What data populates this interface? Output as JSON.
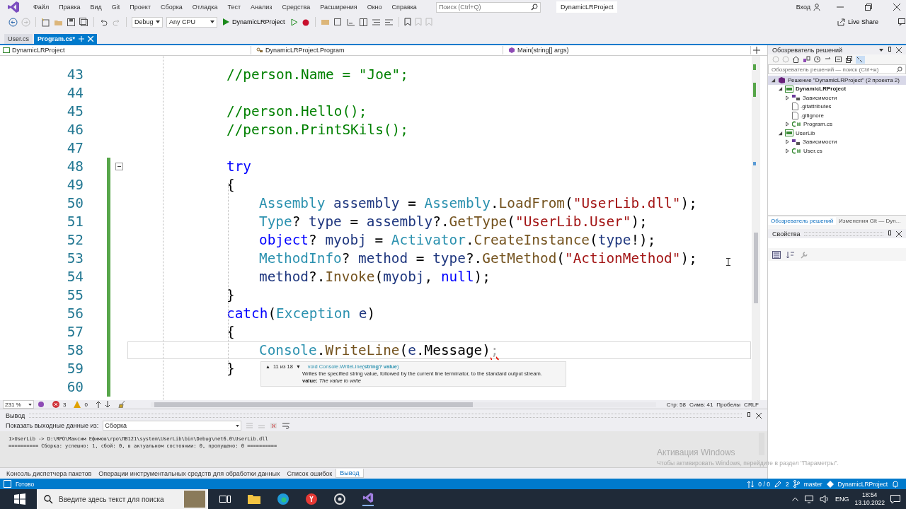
{
  "title_bar": {
    "menu": [
      "Файл",
      "Правка",
      "Вид",
      "Git",
      "Проект",
      "Сборка",
      "Отладка",
      "Тест",
      "Анализ",
      "Средства",
      "Расширения",
      "Окно",
      "Справка"
    ],
    "search": {
      "placeholder": "Поиск (Ctrl+Q)"
    },
    "title": "DynamicLRProject",
    "sign_in": "Вход"
  },
  "toolbar": {
    "configuration": "Debug",
    "platform": "Any CPU",
    "run_target": "DynamicLRProject",
    "live_share": "Live Share"
  },
  "doc_tabs": [
    {
      "label": "User.cs",
      "selected": false
    },
    {
      "label": "Program.cs*",
      "selected": true
    }
  ],
  "nav_bar": {
    "project": "DynamicLRProject",
    "class": "DynamicLRProject.Program",
    "member": "Main(string[] args)"
  },
  "editor": {
    "lines": [
      {
        "number": "43",
        "kind": "outer",
        "changed": false,
        "collapsible": false,
        "current": false,
        "tokens": [
          {
            "kind": "comment",
            "text": "//person.Name = \"Joe\";"
          }
        ]
      },
      {
        "number": "44",
        "kind": "blank",
        "changed": false,
        "collapsible": false,
        "current": false
      },
      {
        "number": "45",
        "kind": "outer",
        "changed": false,
        "collapsible": false,
        "current": false,
        "tokens": [
          {
            "kind": "comment",
            "text": "//person.Hello();"
          }
        ]
      },
      {
        "number": "46",
        "kind": "outer",
        "changed": false,
        "collapsible": false,
        "current": false,
        "tokens": [
          {
            "kind": "comment",
            "text": "//person.PrintSKils();"
          }
        ]
      },
      {
        "number": "47",
        "kind": "blank",
        "changed": false,
        "collapsible": false,
        "current": false
      },
      {
        "number": "48",
        "kind": "outer",
        "changed": true,
        "collapsible": true,
        "current": false,
        "tokens": [
          {
            "kind": "keyword",
            "text": "try"
          }
        ]
      },
      {
        "number": "49",
        "kind": "outer",
        "changed": true,
        "collapsible": false,
        "current": false,
        "tokens": [
          {
            "kind": "plain",
            "text": "{"
          }
        ]
      },
      {
        "number": "50",
        "kind": "inner",
        "changed": true,
        "collapsible": false,
        "current": false,
        "tokens": [
          {
            "kind": "type",
            "text": "Assembly"
          },
          {
            "kind": "local",
            "text": " assembly"
          },
          {
            "kind": "plain",
            "text": " = "
          },
          {
            "kind": "type",
            "text": "Assembly"
          },
          {
            "kind": "plain",
            "text": "."
          },
          {
            "kind": "method",
            "text": "LoadFrom"
          },
          {
            "kind": "plain",
            "text": "("
          },
          {
            "kind": "string",
            "text": "\"UserLib.dll\""
          },
          {
            "kind": "plain",
            "text": ");"
          }
        ]
      },
      {
        "number": "51",
        "kind": "inner",
        "changed": true,
        "collapsible": false,
        "current": false,
        "tokens": [
          {
            "kind": "type",
            "text": "Type"
          },
          {
            "kind": "plain",
            "text": "? "
          },
          {
            "kind": "local",
            "text": "type"
          },
          {
            "kind": "plain",
            "text": " = "
          },
          {
            "kind": "local",
            "text": "assembly"
          },
          {
            "kind": "plain",
            "text": "?."
          },
          {
            "kind": "method",
            "text": "GetType"
          },
          {
            "kind": "plain",
            "text": "("
          },
          {
            "kind": "string",
            "text": "\"UserLib.User\""
          },
          {
            "kind": "plain",
            "text": ");"
          }
        ]
      },
      {
        "number": "52",
        "kind": "inner",
        "changed": true,
        "collapsible": false,
        "current": false,
        "tokens": [
          {
            "kind": "keyword",
            "text": "object"
          },
          {
            "kind": "plain",
            "text": "? "
          },
          {
            "kind": "local",
            "text": "myobj"
          },
          {
            "kind": "plain",
            "text": " = "
          },
          {
            "kind": "type",
            "text": "Activator"
          },
          {
            "kind": "plain",
            "text": "."
          },
          {
            "kind": "method",
            "text": "CreateInstance"
          },
          {
            "kind": "plain",
            "text": "("
          },
          {
            "kind": "local",
            "text": "type"
          },
          {
            "kind": "plain",
            "text": "!);"
          }
        ]
      },
      {
        "number": "53",
        "kind": "inner",
        "changed": true,
        "collapsible": false,
        "current": false,
        "tokens": [
          {
            "kind": "type",
            "text": "MethodInfo"
          },
          {
            "kind": "plain",
            "text": "? "
          },
          {
            "kind": "local",
            "text": "method"
          },
          {
            "kind": "plain",
            "text": " = "
          },
          {
            "kind": "local",
            "text": "type"
          },
          {
            "kind": "plain",
            "text": "?."
          },
          {
            "kind": "method",
            "text": "GetMethod"
          },
          {
            "kind": "plain",
            "text": "("
          },
          {
            "kind": "string",
            "text": "\"ActionMethod\""
          },
          {
            "kind": "plain",
            "text": ");"
          }
        ]
      },
      {
        "number": "54",
        "kind": "inner",
        "changed": true,
        "collapsible": false,
        "current": false,
        "tokens": [
          {
            "kind": "local",
            "text": "method"
          },
          {
            "kind": "plain",
            "text": "?."
          },
          {
            "kind": "method",
            "text": "Invoke"
          },
          {
            "kind": "plain",
            "text": "("
          },
          {
            "kind": "local",
            "text": "myobj"
          },
          {
            "kind": "plain",
            "text": ", "
          },
          {
            "kind": "keyword",
            "text": "null"
          },
          {
            "kind": "plain",
            "text": ");"
          }
        ]
      },
      {
        "number": "55",
        "kind": "outer",
        "changed": true,
        "collapsible": false,
        "current": false,
        "tokens": [
          {
            "kind": "plain",
            "text": "}"
          }
        ]
      },
      {
        "number": "56",
        "kind": "outer",
        "changed": true,
        "collapsible": false,
        "current": false,
        "tokens": [
          {
            "kind": "keyword",
            "text": "catch"
          },
          {
            "kind": "plain",
            "text": "("
          },
          {
            "kind": "type",
            "text": "Exception"
          },
          {
            "kind": "local",
            "text": " e"
          },
          {
            "kind": "plain",
            "text": ")"
          }
        ]
      },
      {
        "number": "57",
        "kind": "outer",
        "changed": true,
        "collapsible": false,
        "current": false,
        "tokens": [
          {
            "kind": "plain",
            "text": "{"
          }
        ]
      },
      {
        "number": "58",
        "kind": "inner",
        "changed": true,
        "collapsible": false,
        "current": true,
        "tokens": [
          {
            "kind": "type",
            "text": "Console"
          },
          {
            "kind": "plain",
            "text": "."
          },
          {
            "kind": "method",
            "text": "WriteLine"
          },
          {
            "kind": "plain",
            "text": "("
          },
          {
            "kind": "local",
            "text": "e"
          },
          {
            "kind": "plain",
            "text": ".Message)"
          },
          {
            "kind": "ghost",
            "text": ";"
          }
        ]
      },
      {
        "number": "59",
        "kind": "outer",
        "changed": true,
        "collapsible": false,
        "current": false,
        "tokens": [
          {
            "kind": "plain",
            "text": "}"
          }
        ]
      },
      {
        "number": "60",
        "kind": "blank",
        "changed": true,
        "collapsible": false,
        "current": false
      }
    ],
    "tooltip": {
      "counter_up": "▲",
      "counter": "11 из 18",
      "counter_down": "▼",
      "signature": "void Console.WriteLine(**string? value**)",
      "description": "Writes the specified string value, followed by the current line terminator, to the standard output stream.",
      "param": "**value:** *The value to write*"
    },
    "status": {
      "zoom": "231 %",
      "errors": "3",
      "warnings": "0",
      "line": "Стр: 58",
      "column": "Симв: 41",
      "whitespace": "Пробелы",
      "line_endings": "CRLF"
    }
  },
  "output": {
    "title": "Вывод",
    "source_label": "Показать выходные данные из:",
    "source": "Сборка",
    "lines": [
      "1>UserLib -> D:\\RPO\\Максим Ефимов\\rpo\\ПВ121\\system\\UserLib\\bin\\Debug\\net6.0\\UserLib.dll",
      "========== Сборка: успешно: 1, сбой: 0, в актуальном состоянии: 0, пропущено: 0 =========="
    ]
  },
  "bottom_tabs": [
    {
      "label": "Консоль диспетчера пакетов",
      "selected": false
    },
    {
      "label": "Операции инструментальных средств для обработки данных",
      "selected": false
    },
    {
      "label": "Список ошибок",
      "selected": false
    },
    {
      "label": "Вывод",
      "selected": true
    }
  ],
  "solution_explorer": {
    "title": "Обозреватель решений",
    "search": {
      "placeholder": "Обозреватель решений — поиск (Ctrl+ж)"
    },
    "tree": [
      {
        "label": "Решение \"DynamicLRProject\" (2 проекта 2)",
        "kind": "solution",
        "bold": false,
        "expandable": true,
        "expanded": true,
        "selected": true,
        "children": [
          {
            "label": "DynamicLRProject",
            "kind": "project",
            "bold": true,
            "expandable": true,
            "expanded": true,
            "selected": false,
            "children": [
              {
                "label": "Зависимости",
                "kind": "deps",
                "bold": false,
                "expandable": true,
                "expanded": false,
                "selected": false
              },
              {
                "label": ".gitattributes",
                "kind": "file",
                "bold": false,
                "expandable": false,
                "expanded": false,
                "selected": false
              },
              {
                "label": ".gitignore",
                "kind": "file",
                "bold": false,
                "expandable": false,
                "expanded": false,
                "selected": false
              },
              {
                "label": "Program.cs",
                "kind": "cs",
                "bold": false,
                "expandable": true,
                "expanded": false,
                "selected": false
              }
            ]
          },
          {
            "label": "UserLib",
            "kind": "project",
            "bold": false,
            "expandable": true,
            "expanded": true,
            "selected": false,
            "children": [
              {
                "label": "Зависимости",
                "kind": "deps",
                "bold": false,
                "expandable": true,
                "expanded": false,
                "selected": false
              },
              {
                "label": "User.cs",
                "kind": "cs",
                "bold": false,
                "expandable": true,
                "expanded": false,
                "selected": false
              }
            ]
          }
        ]
      }
    ],
    "tabs": [
      {
        "label": "Обозреватель решений",
        "selected": true
      },
      {
        "label": "Изменения Git — Dyn...",
        "selected": false
      }
    ]
  },
  "properties": {
    "title": "Свойства"
  },
  "activation": {
    "title": "Активация Windows",
    "text": "Чтобы активировать Windows, перейдите в раздел \"Параметры\"."
  },
  "status_bar": {
    "text": "Готово",
    "sync": "0 / 0",
    "changes": "2",
    "branch": "master",
    "repo": "DynamicLRProject"
  },
  "taskbar": {
    "search": {
      "placeholder": "Введите здесь текст для поиска"
    },
    "language": "ENG",
    "time": "18:54",
    "date": "13.10.2022"
  }
}
